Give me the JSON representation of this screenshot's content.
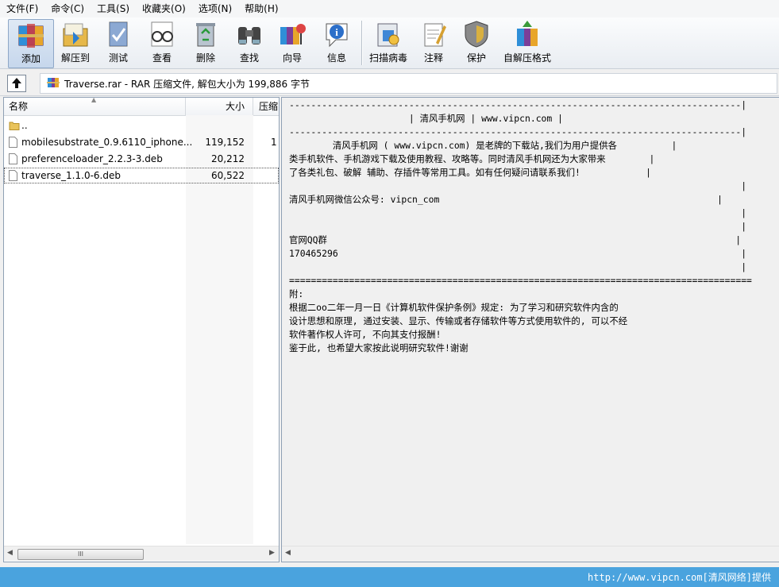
{
  "menu": [
    "文件(F)",
    "命令(C)",
    "工具(S)",
    "收藏夹(O)",
    "选项(N)",
    "帮助(H)"
  ],
  "toolbar": {
    "add": "添加",
    "extract_to": "解压到",
    "test": "测试",
    "view": "查看",
    "delete": "删除",
    "find": "查找",
    "wizard": "向导",
    "info": "信息",
    "virus_scan": "扫描病毒",
    "comment": "注释",
    "protect": "保护",
    "sfx": "自解压格式"
  },
  "address": {
    "path": "Traverse.rar - RAR 压缩文件, 解包大小为 199,886 字节"
  },
  "file_list": {
    "headers": {
      "name": "名称",
      "size": "大小",
      "packed": "压缩"
    },
    "rows": [
      {
        "name": "..",
        "size": "",
        "packed": "",
        "type": "folder"
      },
      {
        "name": "mobilesubstrate_0.9.6110_iphone...",
        "size": "119,152",
        "packed": "1",
        "type": "file"
      },
      {
        "name": "preferenceloader_2.2.3-3.deb",
        "size": "20,212",
        "packed": "",
        "type": "file"
      },
      {
        "name": "traverse_1.1.0-6.deb",
        "size": "60,522",
        "packed": "",
        "type": "file"
      }
    ]
  },
  "scroll_thumb": "III",
  "comment": "-----------------------------------------------------------------------------------|\n                      | 清风手机网 | www.vipcn.com |\n-----------------------------------------------------------------------------------|\n        清风手机网 ( www.vipcn.com) 是老牌的下载站,我们为用户提供各          |\n类手机软件、手机游戏下载及使用教程、攻略等。同时清风手机网还为大家带来        |\n了各类礼包、破解 辅助、存插件等常用工具。如有任何疑问请联系我们!            |\n                                                                                   |\n清风手机网微信公众号: vipcn_com                                                   |\n                                                                                   |\n                                                                                   |\n官网QQ群                                                                           |\n170465296                                                                          |\n                                                                                   |\n=====================================================================================\n附:\n根据二oo二年一月一日《计算机软件保护条例》规定: 为了学习和研究软件内含的\n设计思想和原理, 通过安装、显示、传输或者存储软件等方式使用软件的, 可以不经\n软件著作权人许可, 不向其支付报酬!\n鉴于此, 也希望大家按此说明研究软件!谢谢",
  "watermark": "http://www.vipcn.com[清风网络]提供"
}
